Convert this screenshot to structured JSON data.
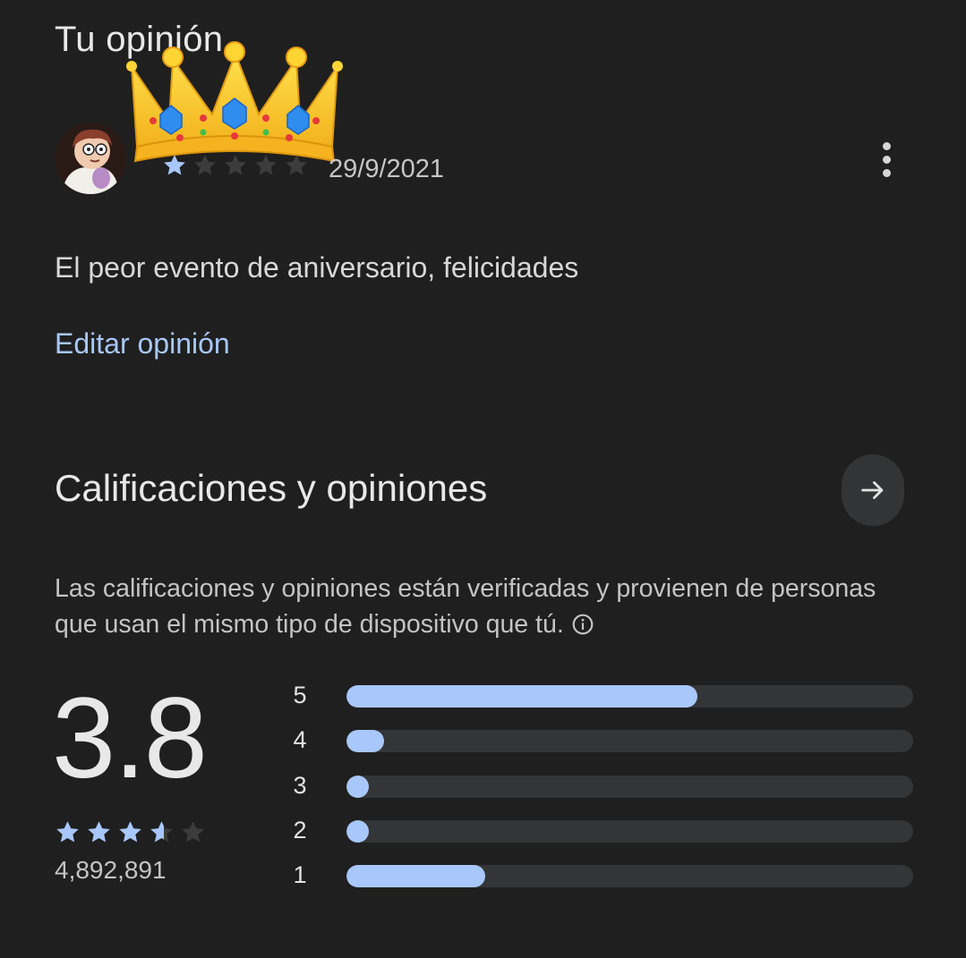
{
  "your_review": {
    "title": "Tu opinión",
    "user_rating": 1,
    "max_rating": 5,
    "date": "29/9/2021",
    "text": "El peor evento de aniversario, felicidades",
    "edit_label": "Editar opinión"
  },
  "ratings": {
    "title": "Calificaciones y opiniones",
    "verified_text": "Las calificaciones y opiniones están verificadas y provienen de personas que usan el mismo tipo de dispositivo que tú.",
    "average": "3.8",
    "average_value": 3.8,
    "total_count": "4,892,891",
    "distribution": [
      {
        "label": "5",
        "fraction": 0.62
      },
      {
        "label": "4",
        "fraction": 0.066
      },
      {
        "label": "3",
        "fraction": 0.04
      },
      {
        "label": "2",
        "fraction": 0.04
      },
      {
        "label": "1",
        "fraction": 0.245
      }
    ]
  },
  "colors": {
    "background": "#1f1f1f",
    "accent": "#a8c7fa",
    "star_filled": "#a8c7fa",
    "star_empty": "#3c3c3c",
    "track": "#333537"
  },
  "icons": {
    "more": "more-vert-icon",
    "arrow": "arrow-right-icon",
    "info": "info-icon",
    "crown": "crown-emoji",
    "avatar": "avatar-image"
  }
}
